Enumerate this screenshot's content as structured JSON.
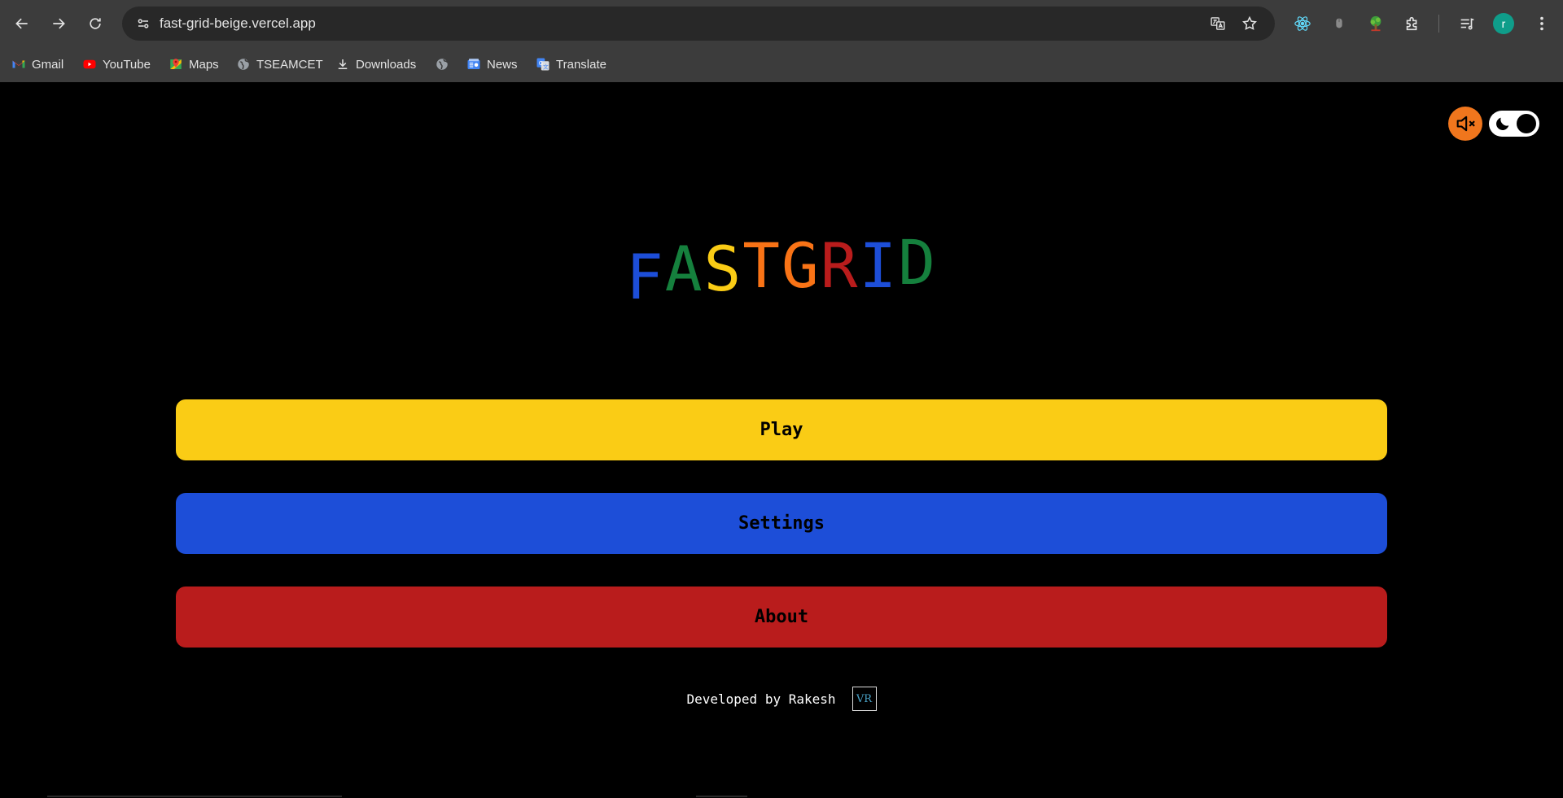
{
  "browser": {
    "url": "fast-grid-beige.vercel.app",
    "profile_initial": "r",
    "icons": {
      "back": "arrow-left-icon",
      "forward": "arrow-right-icon",
      "reload": "reload-icon",
      "site_info": "tune-icon",
      "translate": "translate-icon",
      "bookmark": "star-icon",
      "extensions": [
        "react-devtools-icon",
        "mouse-icon",
        "tree-icon",
        "puzzle-icon"
      ],
      "media": "playlist-icon",
      "menu": "kebab-menu-icon"
    }
  },
  "bookmarks": [
    {
      "label": "Gmail",
      "icon": "gmail-icon"
    },
    {
      "label": "YouTube",
      "icon": "youtube-icon"
    },
    {
      "label": "Maps",
      "icon": "maps-icon"
    },
    {
      "label": "TSEAMCET",
      "icon": "globe-icon"
    },
    {
      "label": "Downloads",
      "icon": "download-icon"
    },
    {
      "label": "",
      "icon": "globe-icon"
    },
    {
      "label": "News",
      "icon": "google-news-icon"
    },
    {
      "label": "Translate",
      "icon": "google-translate-icon"
    }
  ],
  "game": {
    "title_letters": [
      {
        "char": "F",
        "color": "#1d4ed8"
      },
      {
        "char": "A",
        "color": "#15803d"
      },
      {
        "char": "S",
        "color": "#facc15"
      },
      {
        "char": "T",
        "color": "#f97316"
      },
      {
        "char": "G",
        "color": "#f97316"
      },
      {
        "char": "R",
        "color": "#b91c1c"
      },
      {
        "char": "I",
        "color": "#1d4ed8"
      },
      {
        "char": "D",
        "color": "#15803d"
      }
    ],
    "buttons": {
      "play": {
        "label": "Play",
        "color": "#facc15"
      },
      "settings": {
        "label": "Settings",
        "color": "#1d4ed8"
      },
      "about": {
        "label": "About",
        "color": "#b91c1c"
      }
    },
    "sound_button": {
      "icon": "volume-muted-icon",
      "color": "#f0761d"
    },
    "theme_toggle": {
      "icon": "moon-icon",
      "state": "dark"
    },
    "footer": {
      "text": "Developed by Rakesh",
      "badge": "VR"
    }
  }
}
